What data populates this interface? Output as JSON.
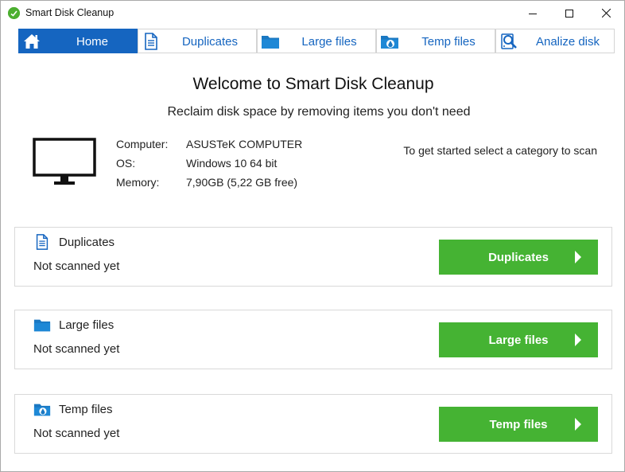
{
  "window": {
    "title": "Smart Disk Cleanup",
    "accent_color": "#1565c0",
    "action_color": "#45b333"
  },
  "tabs": [
    {
      "label": "Home",
      "icon": "home-icon",
      "active": true
    },
    {
      "label": "Duplicates",
      "icon": "document-icon",
      "active": false
    },
    {
      "label": "Large files",
      "icon": "folder-icon",
      "active": false
    },
    {
      "label": "Temp files",
      "icon": "temp-folder-icon",
      "active": false
    },
    {
      "label": "Analize disk",
      "icon": "disk-magnifier-icon",
      "active": false
    }
  ],
  "home": {
    "title": "Welcome to Smart Disk Cleanup",
    "subtitle": "Reclaim disk space by removing items you don't need",
    "get_started": "To get started select a category to scan",
    "system_info": [
      {
        "label": "Computer:",
        "value": "ASUSTeK COMPUTER"
      },
      {
        "label": "OS:",
        "value": "Windows 10 64 bit"
      },
      {
        "label": "Memory:",
        "value": "7,90GB (5,22 GB free)"
      }
    ],
    "categories": [
      {
        "title": "Duplicates",
        "status": "Not scanned yet",
        "button": "Duplicates",
        "icon": "document-icon"
      },
      {
        "title": "Large files",
        "status": "Not scanned yet",
        "button": "Large files",
        "icon": "folder-icon"
      },
      {
        "title": "Temp files",
        "status": "Not scanned yet",
        "button": "Temp files",
        "icon": "temp-folder-icon"
      }
    ]
  }
}
